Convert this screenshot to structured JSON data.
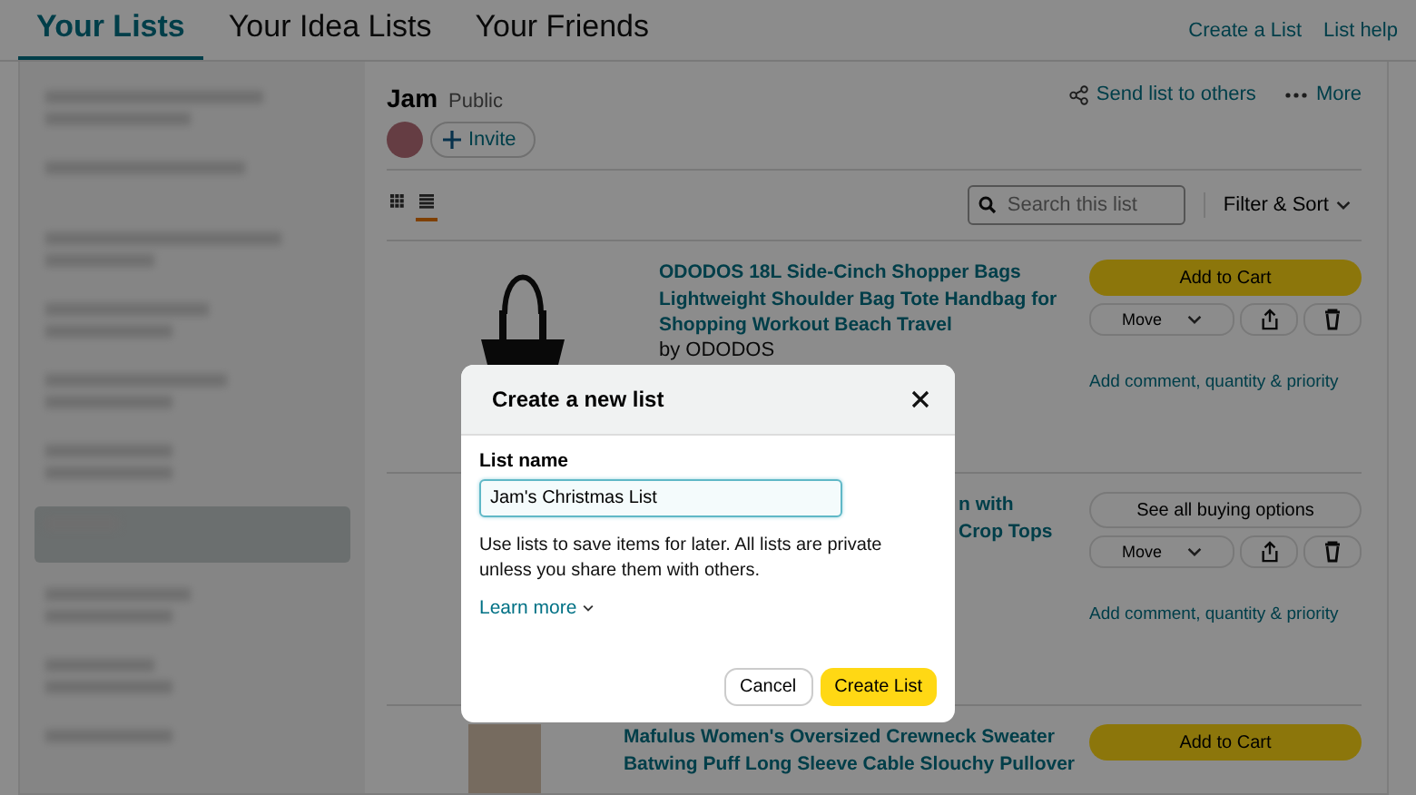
{
  "tabs": [
    {
      "label": "Your Lists",
      "selected": true
    },
    {
      "label": "Your Idea Lists",
      "selected": false
    },
    {
      "label": "Your Friends",
      "selected": false
    }
  ],
  "header_links": [
    "Create a List",
    "List help"
  ],
  "sidebar": {
    "items": [
      {
        "selected": false
      },
      {
        "selected": false
      },
      {
        "selected": false
      },
      {
        "selected": false
      },
      {
        "selected": false
      },
      {
        "selected": false
      },
      {
        "selected": true
      },
      {
        "selected": false
      },
      {
        "selected": false
      },
      {
        "selected": false
      }
    ]
  },
  "list": {
    "name": "Jam",
    "privacy": "Public",
    "invite": "Invite",
    "send": "Send list to others",
    "more": "More",
    "views": [
      {
        "selected": false
      },
      {
        "selected": true
      }
    ],
    "search_placeholder": "Search this list",
    "filter": "Filter & Sort"
  },
  "items": [
    {
      "kind": "cart",
      "title_lines": [
        "ODODOS 18L Side-Cinch Shopper Bags",
        "Lightweight Shoulder Bag Tote Handbag for",
        "Shopping Workout Beach Travel"
      ],
      "covered_left": false,
      "byline": "by ODODOS",
      "primary": "Add to Cart",
      "move": "Move",
      "comment": "Add comment, quantity & priority"
    },
    {
      "kind": "options",
      "title_lines": [
        "n with",
        "Crop Tops"
      ],
      "covered_left": true,
      "primary": "See all buying options",
      "move": "Move",
      "comment": "Add comment, quantity & priority"
    },
    {
      "kind": "cart",
      "title_lines": [
        "Mafulus Women's Oversized Crewneck Sweater",
        "Batwing Puff Long Sleeve Cable Slouchy Pullover"
      ],
      "covered_left": false,
      "primary": "Add to Cart"
    }
  ],
  "dialog": {
    "title": "Create a new list",
    "field_label": "List name",
    "value": "Jam's Christmas List",
    "help": "Use lists to save items for later. All lists are private unless you share them with others.",
    "learn_more": "Learn more",
    "cancel": "Cancel",
    "create": "Create List"
  }
}
